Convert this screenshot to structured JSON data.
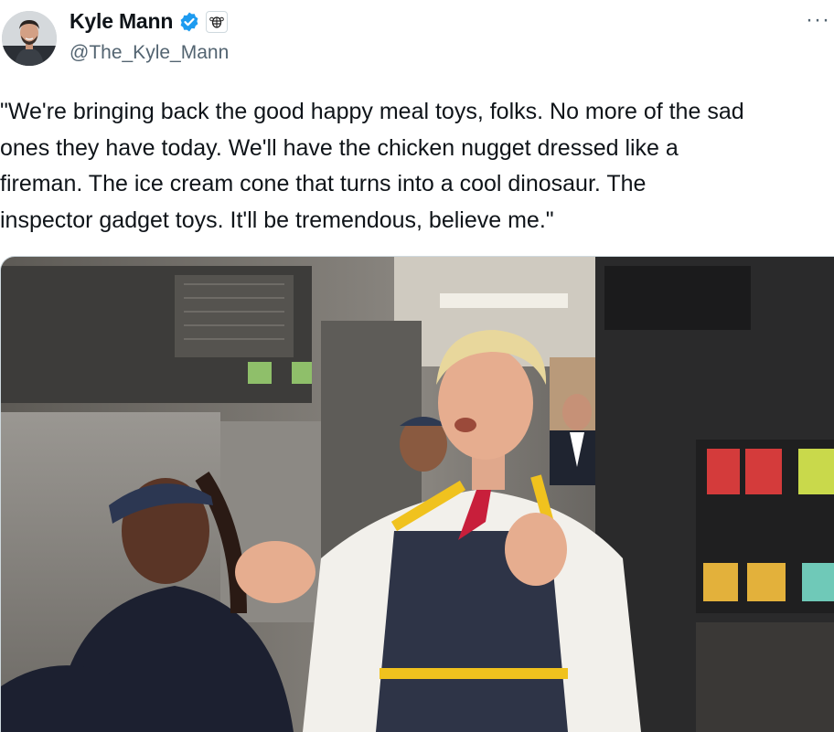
{
  "author": {
    "display_name": "Kyle Mann",
    "handle": "@The_Kyle_Mann",
    "verified": true,
    "affiliate_badge_icon": "babylon-bee-icon"
  },
  "tweet": {
    "lines": [
      "\"We're bringing back the good happy meal toys, folks. No more of the sad",
      "ones they have today. We'll have the chicken nugget dressed like a",
      "fireman. The ice cream cone that turns into a cool dinosaur. The",
      "inspector gadget toys. It'll be tremendous, believe me.\""
    ]
  },
  "media": {
    "type": "video-still",
    "description_icon": "fast-food-kitchen-photo"
  },
  "more_menu_label": "···",
  "colors": {
    "verified_blue": "#1d9bf0",
    "text_primary": "#0f1419",
    "text_secondary": "#536471",
    "border": "#cfd9de"
  }
}
